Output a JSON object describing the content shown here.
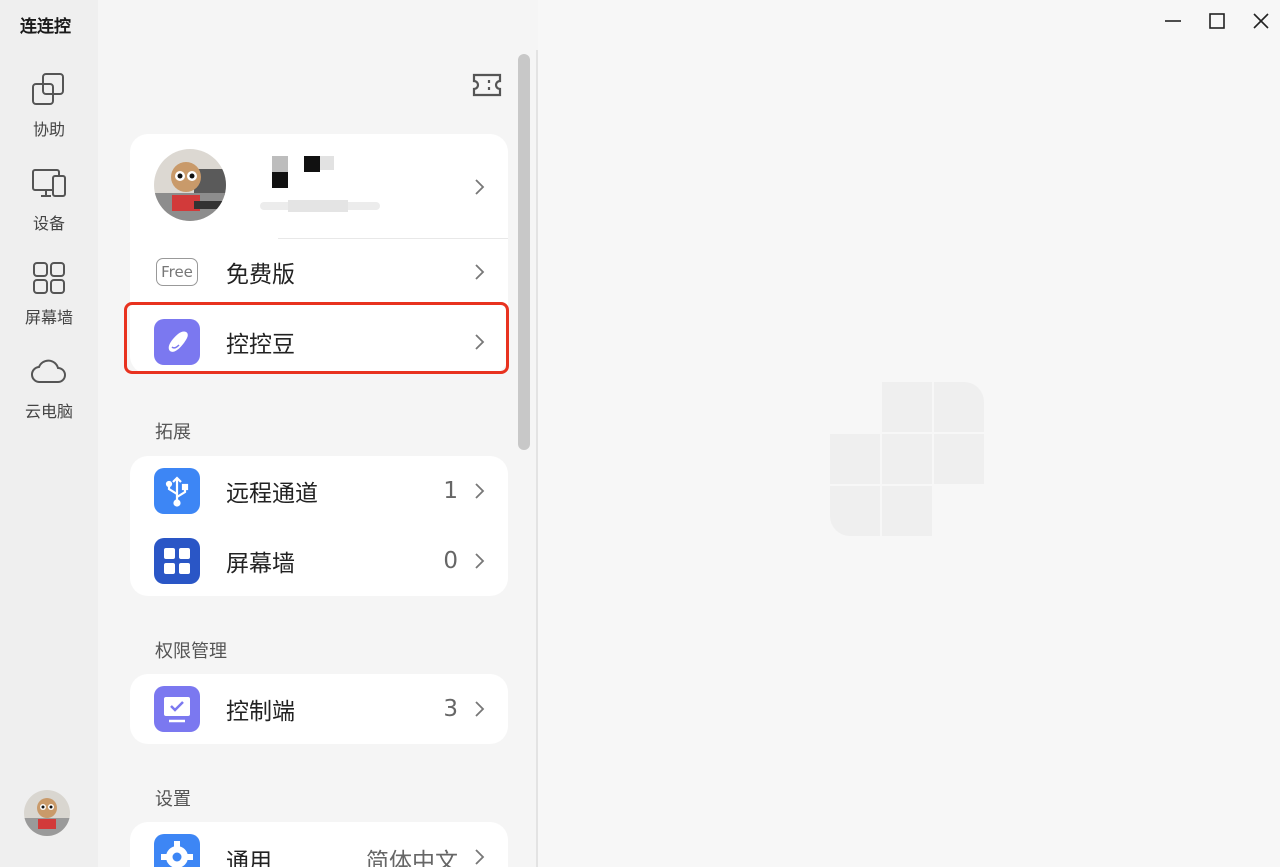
{
  "app": {
    "title": "连连控"
  },
  "rail": {
    "items": [
      {
        "label": "协助",
        "icon": "assist-icon"
      },
      {
        "label": "设备",
        "icon": "device-icon"
      },
      {
        "label": "屏幕墙",
        "icon": "screen-wall-icon"
      },
      {
        "label": "云电脑",
        "icon": "cloud-icon"
      }
    ]
  },
  "profile": {
    "plan_label": "免费版",
    "plan_badge": "Free"
  },
  "beans": {
    "label": "控控豆"
  },
  "sections": {
    "extension": "拓展",
    "permissions": "权限管理",
    "settings": "设置"
  },
  "extension_rows": [
    {
      "label": "远程通道",
      "count": "1"
    },
    {
      "label": "屏幕墙",
      "count": "0"
    }
  ],
  "permission_rows": [
    {
      "label": "控制端",
      "count": "3"
    }
  ],
  "settings_rows": [
    {
      "label": "通用",
      "value": "简体中文"
    }
  ],
  "colors": {
    "accent_purple": "#7b78f0",
    "accent_blue": "#3d86f5",
    "navy": "#2a56c6",
    "highlight": "#e8321f"
  }
}
